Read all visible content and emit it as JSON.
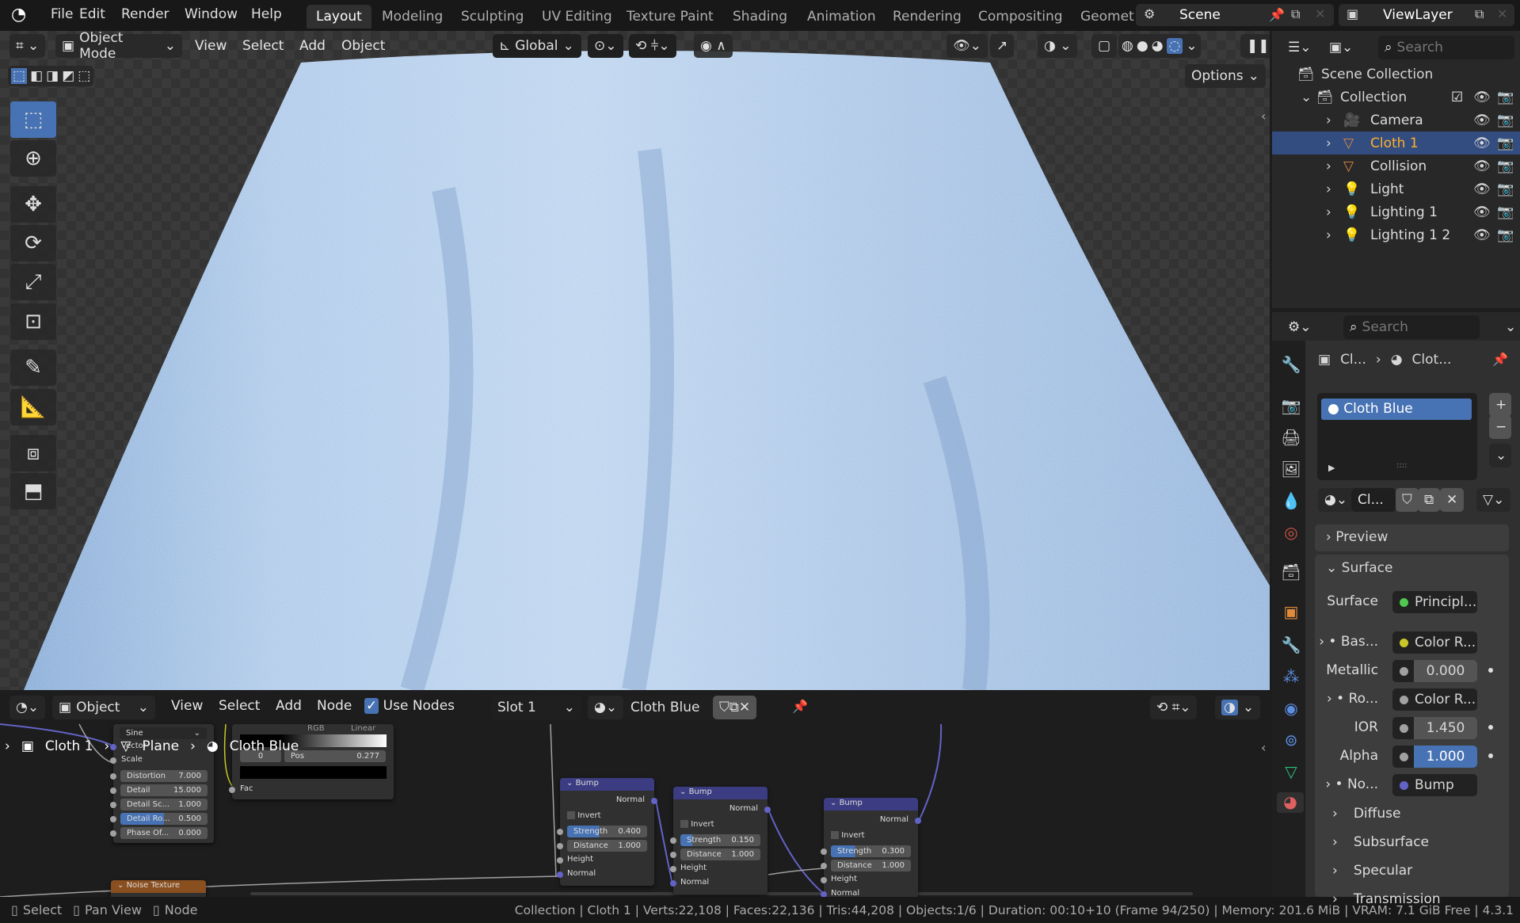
{
  "topbar": {
    "menu": [
      "File",
      "Edit",
      "Render",
      "Window",
      "Help"
    ],
    "workspaces": [
      "Layout",
      "Modeling",
      "Sculpting",
      "UV Editing",
      "Texture Paint",
      "Shading",
      "Animation",
      "Rendering",
      "Compositing",
      "Geometry Nodes"
    ],
    "scene": "Scene",
    "view_layer": "ViewLayer"
  },
  "viewport": {
    "mode": "Object Mode",
    "menus": [
      "View",
      "Select",
      "Add",
      "Object"
    ],
    "orientation": "Global",
    "options": "Options"
  },
  "outliner": {
    "search_placeholder": "Search",
    "scene_collection": "Scene Collection",
    "collection": "Collection",
    "items": [
      {
        "name": "Camera",
        "icon": "camera-icon",
        "selected": false
      },
      {
        "name": "Cloth 1",
        "icon": "mesh-icon",
        "selected": true
      },
      {
        "name": "Collision",
        "icon": "mesh-icon",
        "selected": false
      },
      {
        "name": "Light",
        "icon": "light-icon",
        "selected": false
      },
      {
        "name": "Lighting 1",
        "icon": "light-icon",
        "selected": false
      },
      {
        "name": "Lighting 1 2",
        "icon": "light-icon",
        "selected": false
      }
    ]
  },
  "properties": {
    "search_placeholder": "Search",
    "breadcrumb": [
      "Cl...",
      "Clot..."
    ],
    "material_slot": "Cloth Blue",
    "material_name": "Cl...",
    "preview": "Preview",
    "surface_panel": "Surface",
    "rows": [
      {
        "label": "Surface",
        "value": "Principl...",
        "dot": "#4fc94f",
        "kind": "link"
      },
      {
        "label": "Bas...",
        "value": "Color R...",
        "dot": "#c7c729",
        "kind": "link",
        "expand": true
      },
      {
        "label": "Metallic",
        "value": "0.000",
        "dot": "#a1a1a1",
        "kind": "num"
      },
      {
        "label": "Ro...",
        "value": "Color R...",
        "dot": "#a1a1a1",
        "kind": "link",
        "expand": true
      },
      {
        "label": "IOR",
        "value": "1.450",
        "dot": "#a1a1a1",
        "kind": "num"
      },
      {
        "label": "Alpha",
        "value": "1.000",
        "dot": "#a1a1a1",
        "kind": "numsel"
      },
      {
        "label": "No...",
        "value": "Bump",
        "dot": "#6363c7",
        "kind": "link",
        "expand": true
      }
    ],
    "subpanels": [
      "Diffuse",
      "Subsurface",
      "Specular",
      "Transmission"
    ]
  },
  "node_editor": {
    "type": "Object",
    "menus": [
      "View",
      "Select",
      "Add",
      "Node"
    ],
    "use_nodes": "Use Nodes",
    "slot": "Slot 1",
    "material": "Cloth Blue",
    "breadcrumb": [
      "Cloth 1",
      "Plane",
      "Cloth Blue"
    ],
    "noise_node": {
      "mode": "Sine",
      "inputs": [
        "Vector",
        "Scale"
      ],
      "fields": [
        {
          "label": "Distortion",
          "value": "7.000"
        },
        {
          "label": "Detail",
          "value": "15.000"
        },
        {
          "label": "Detail Sc...",
          "value": "1.000"
        },
        {
          "label": "Detail Ro...",
          "value": "0.500"
        },
        {
          "label": "Phase Of...",
          "value": "0.000"
        }
      ]
    },
    "ramp_node": {
      "mode1": "RGB",
      "mode2": "Linear",
      "index": "0",
      "pos_label": "Pos",
      "pos": "0.277",
      "fac": "Fac"
    },
    "noise_texture_title": "Noise Texture",
    "bumps": [
      {
        "title": "Bump",
        "strength": "0.400",
        "strength_frac": 0.4,
        "distance": "1.000"
      },
      {
        "title": "Bump",
        "strength": "0.150",
        "strength_frac": 0.15,
        "distance": "1.000"
      },
      {
        "title": "Bump",
        "strength": "0.300",
        "strength_frac": 0.3,
        "distance": "1.000"
      }
    ],
    "bump_labels": {
      "normal": "Normal",
      "invert": "Invert",
      "strength": "Strength",
      "distance": "Distance",
      "height": "Height"
    }
  },
  "statusbar": {
    "hints": [
      "Select",
      "Pan View",
      "Node"
    ],
    "info": "Collection | Cloth 1 | Verts:22,108 | Faces:22,136 | Tris:44,208 | Objects:1/6 | Duration: 00:10+10 (Frame 94/250) | Memory: 201.6 MiB | VRAM: 7.1 GiB Free | 4.3.1"
  }
}
